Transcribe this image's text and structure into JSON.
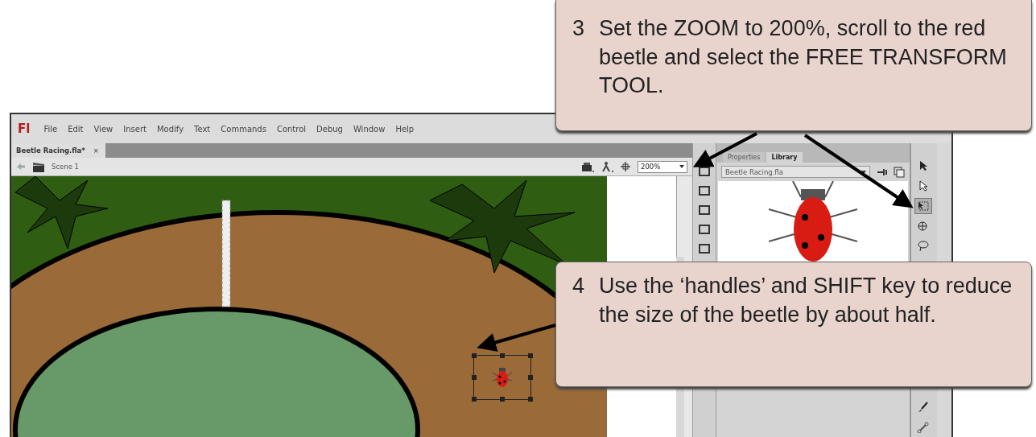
{
  "app": {
    "logo": "Fl",
    "menu": [
      "File",
      "Edit",
      "View",
      "Insert",
      "Modify",
      "Text",
      "Commands",
      "Control",
      "Debug",
      "Window",
      "Help"
    ]
  },
  "document_tab": {
    "label": "Beetle Racing.fla*",
    "close": "×"
  },
  "edit_bar": {
    "scene": "Scene 1",
    "zoom": "200%"
  },
  "library_panel": {
    "tabs": [
      {
        "label": "Properties",
        "selected": false
      },
      {
        "label": "Library",
        "selected": true
      }
    ],
    "document": "Beetle Racing.fla"
  },
  "tools": [
    {
      "kind": "selection",
      "selected": false
    },
    {
      "kind": "subselection",
      "selected": false
    },
    {
      "kind": "free-transform",
      "selected": true
    },
    {
      "kind": "rotation",
      "selected": false
    },
    {
      "kind": "lasso",
      "selected": false
    },
    {
      "kind": "brush",
      "selected": false
    },
    {
      "kind": "bone",
      "selected": false
    }
  ],
  "callouts": [
    {
      "number": "3",
      "text": "Set the ZOOM to 200%, scroll to the red beetle and select the FREE TRANSFORM TOOL."
    },
    {
      "number": "4",
      "text": "Use the ‘handles’ and SHIFT key to reduce the size of the beetle by about half."
    }
  ]
}
